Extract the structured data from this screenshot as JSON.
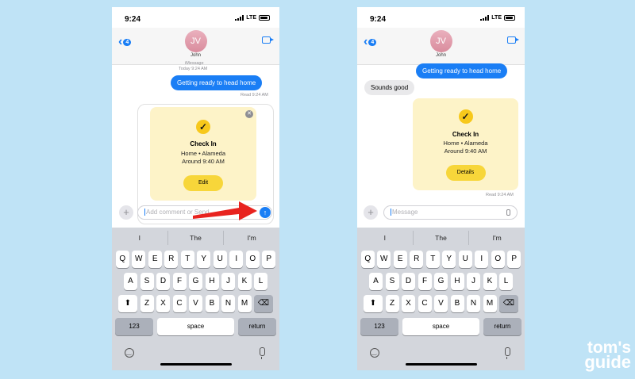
{
  "status": {
    "time": "9:24",
    "network": "LTE"
  },
  "contact": {
    "initials": "JV",
    "name": "John",
    "back_badge": "4"
  },
  "left": {
    "partial_meta": "iMessage",
    "timestamp": "Today 9:24 AM",
    "sent_message": "Getting ready to head home",
    "read_receipt": "Read 9:24 AM",
    "card": {
      "title": "Check In",
      "location": "Home • Alameda",
      "eta": "Around 9:40 AM",
      "button": "Edit"
    },
    "input_placeholder": "Add comment or Send"
  },
  "right": {
    "sent_message": "Getting ready to head home",
    "received_message": "Sounds good",
    "card": {
      "title": "Check In",
      "location": "Home • Alameda",
      "eta": "Around 9:40 AM",
      "button": "Details"
    },
    "read_receipt": "Read 9:24 AM",
    "input_placeholder": "Message"
  },
  "keyboard": {
    "suggestions": [
      "I",
      "The",
      "I'm"
    ],
    "row1": [
      "Q",
      "W",
      "E",
      "R",
      "T",
      "Y",
      "U",
      "I",
      "O",
      "P"
    ],
    "row2": [
      "A",
      "S",
      "D",
      "F",
      "G",
      "H",
      "J",
      "K",
      "L"
    ],
    "row3": [
      "Z",
      "X",
      "C",
      "V",
      "B",
      "N",
      "M"
    ],
    "numbers_key": "123",
    "space_key": "space",
    "return_key": "return"
  },
  "watermark": {
    "line1": "tom's",
    "line2": "guide"
  },
  "colors": {
    "imessage_blue": "#1a7ef5",
    "card_bg": "#fdf3c8",
    "card_button": "#f7d63a",
    "annotation_arrow": "#e8231f"
  }
}
